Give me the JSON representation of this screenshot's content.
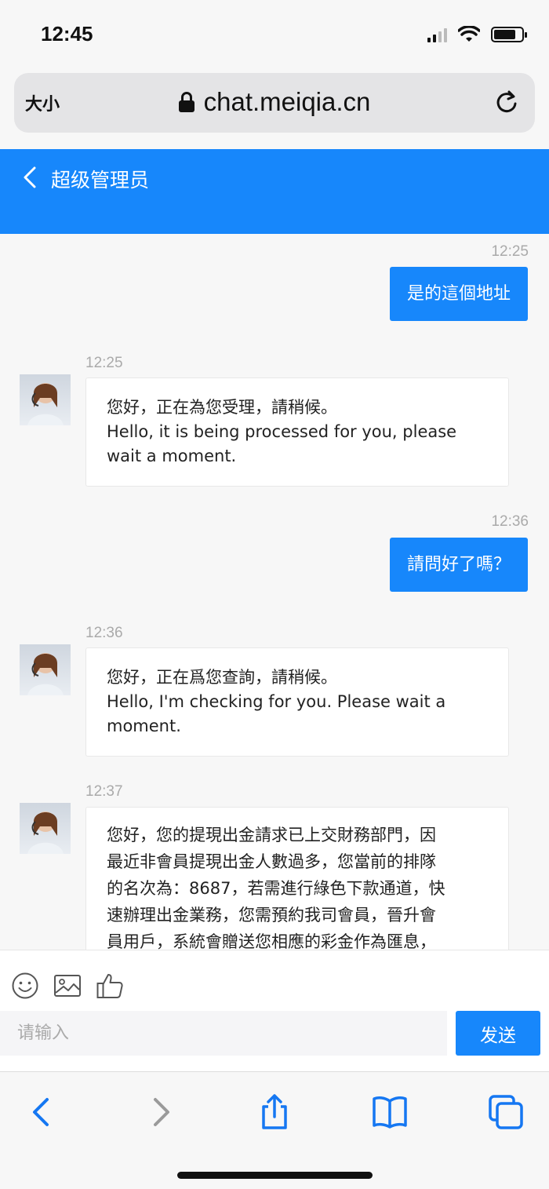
{
  "status_bar": {
    "time": "12:45"
  },
  "browser": {
    "text_size_label": "大小",
    "url": "chat.meiqia.cn"
  },
  "chat_header": {
    "title": "超级管理员"
  },
  "messages": [
    {
      "direction": "out",
      "time": "12:25",
      "text": "是的這個地址"
    },
    {
      "direction": "in",
      "time": "12:25",
      "lines": [
        "您好，正在為您受理，請稍候。",
        "Hello, it is being processed for you, please",
        "wait a moment."
      ]
    },
    {
      "direction": "out",
      "time": "12:36",
      "text": "請問好了嗎？"
    },
    {
      "direction": "in",
      "time": "12:36",
      "lines": [
        "您好，正在爲您查詢，請稍候。",
        "Hello, I'm checking for you. Please wait a",
        "moment."
      ]
    },
    {
      "direction": "in",
      "time": "12:37",
      "lines": [
        "您好，您的提現出金請求已上交財務部門，因",
        "最近非會員提現出金人數過多，您當前的排隊",
        "的名次為：8687，若需進行綠色下款通道，快",
        "速辦理出金業務，您需預約我司會員，晉升會",
        "員用戶，系統會贈送您相應的彩金作為匯息，"
      ]
    }
  ],
  "composer": {
    "placeholder": "请输入",
    "send_label": "发送"
  },
  "icons": [
    "emoji-icon",
    "image-icon",
    "thumbs-up-icon",
    "back-icon",
    "forward-icon",
    "share-icon",
    "bookmarks-icon",
    "tabs-icon",
    "lock-icon",
    "reload-icon",
    "chevron-left-icon"
  ],
  "colors": {
    "accent": "#1787fb"
  }
}
